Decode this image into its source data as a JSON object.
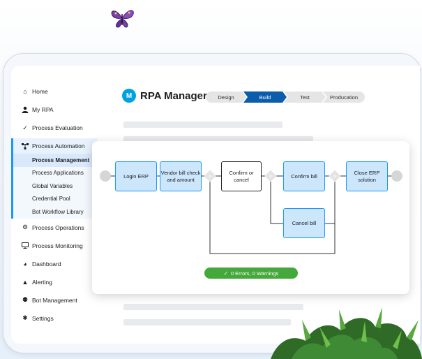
{
  "sidebar": {
    "items": [
      {
        "label": "Home",
        "icon": "home-icon"
      },
      {
        "label": "My RPA",
        "icon": "user-icon"
      },
      {
        "label": "Process Evaluation",
        "icon": "check-icon"
      },
      {
        "label": "Process Automation",
        "icon": "flow-icon"
      }
    ],
    "sub_items": [
      {
        "label": "Process Management"
      },
      {
        "label": "Process Applications"
      },
      {
        "label": "Global Variables"
      },
      {
        "label": "Credential Pool"
      },
      {
        "label": "Bot Workflow Library"
      }
    ],
    "items_after": [
      {
        "label": "Process Operations",
        "icon": "operations-icon"
      },
      {
        "label": "Process Monitoring",
        "icon": "monitor-icon"
      },
      {
        "label": "Dashboard",
        "icon": "pie-chart-icon"
      },
      {
        "label": "Alerting",
        "icon": "alert-icon"
      },
      {
        "label": "Bot Management",
        "icon": "bot-icon"
      },
      {
        "label": "Settings",
        "icon": "gear-icon"
      }
    ]
  },
  "header": {
    "logo_text": "RPA Manager",
    "steps": [
      "Design",
      "Build",
      "Test",
      "Producation"
    ],
    "active_step": "Build"
  },
  "flow": {
    "nodes": {
      "login": "Login ERP",
      "vendor": "Vendor bill check and amount",
      "confirm_or_cancel": "Confirm or cancel",
      "confirm_bill": "Confirm bill",
      "close_erp": "Close ERP solution",
      "cancel_bill": "Cancel bill"
    },
    "status": "0 Errors, 0 Warnings"
  },
  "colors": {
    "accent": "#1b96ff",
    "active_step": "#0b5cab",
    "node_fill": "#cce6fb",
    "success": "#45a83a"
  }
}
